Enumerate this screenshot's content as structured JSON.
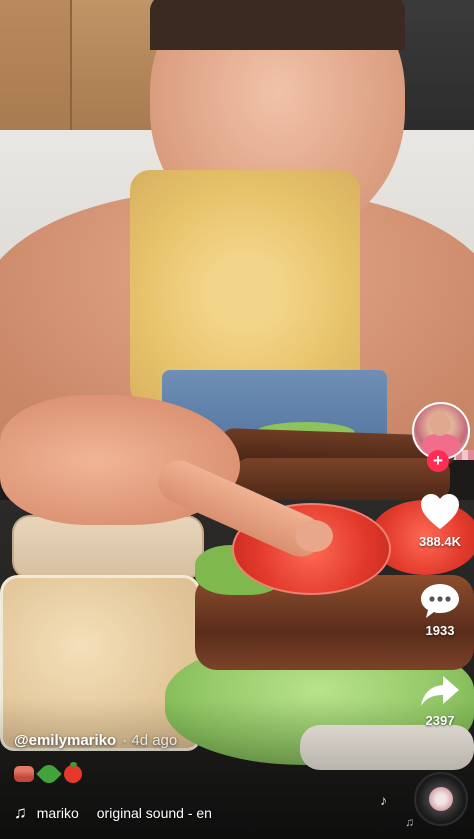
{
  "video": {
    "username": "@emilymariko",
    "posted": "· 4d ago",
    "emoji_caption": [
      "bacon-emoji",
      "leafy-green-emoji",
      "tomato-emoji"
    ]
  },
  "actions": {
    "likes": "388.4K",
    "comments": "1933",
    "shares": "2397",
    "follow_symbol": "+"
  },
  "sound": {
    "icon": "music-note-icon",
    "user": "mariko",
    "title": "original sound - en"
  },
  "colors": {
    "follow_accent": "#ff2d55",
    "text": "#ffffff"
  }
}
